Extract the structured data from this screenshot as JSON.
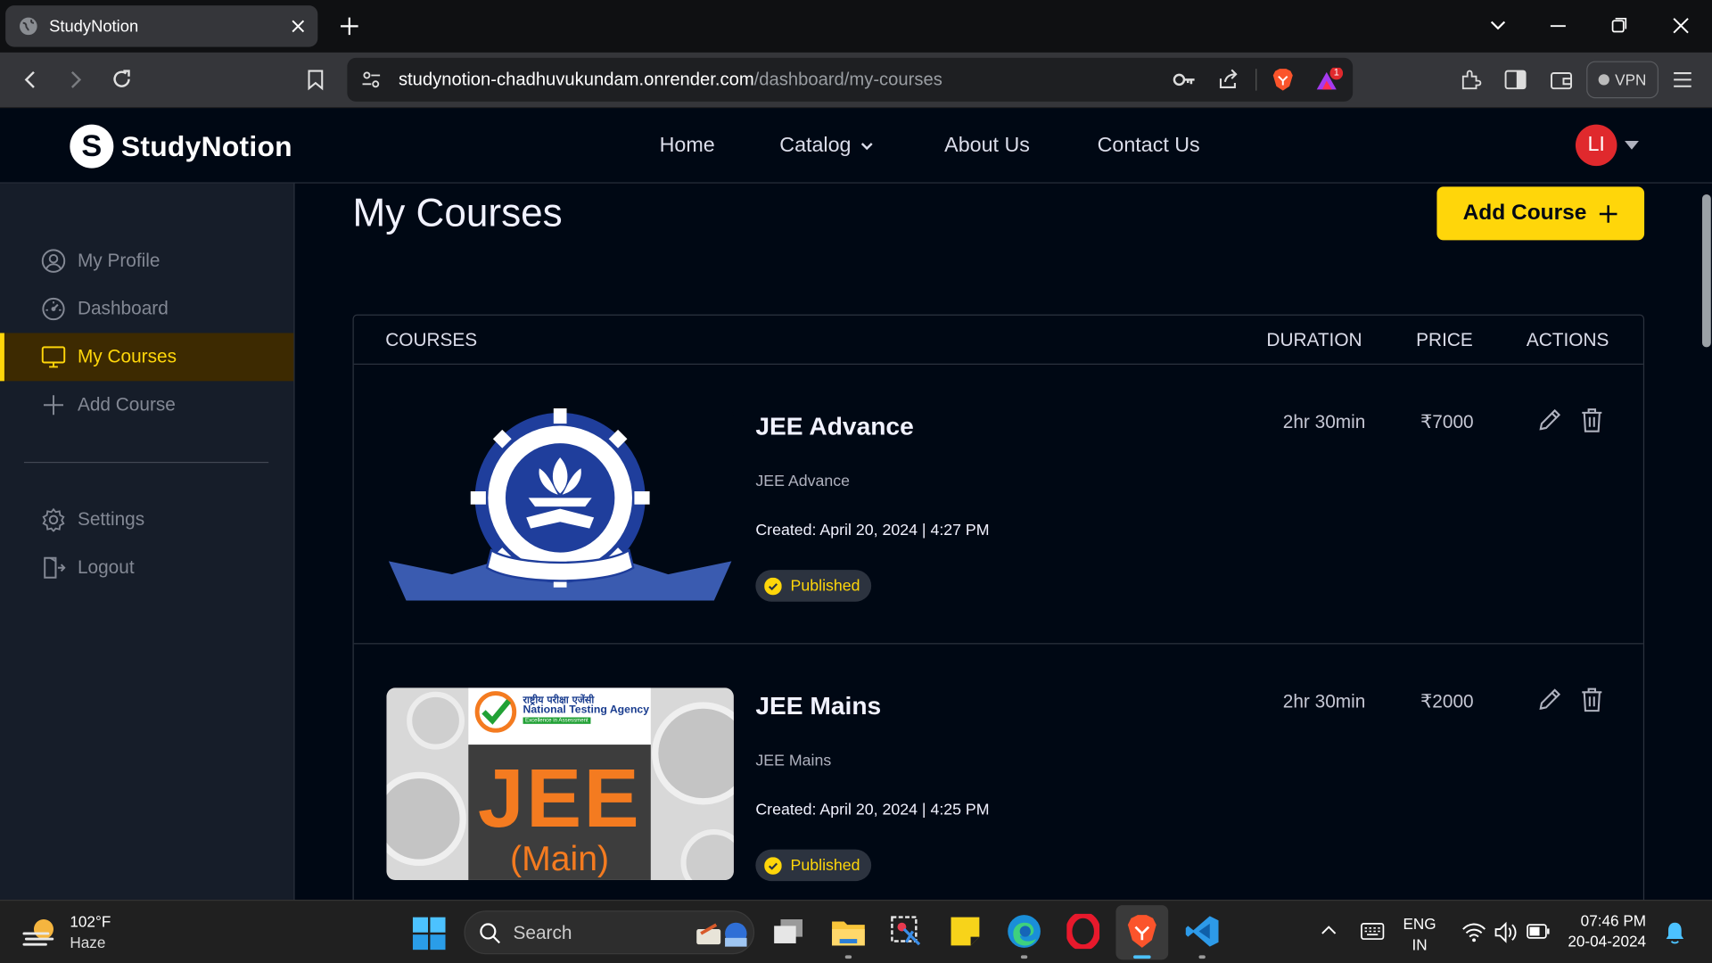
{
  "browser": {
    "tab_title": "StudyNotion",
    "url_domain": "studynotion-chadhuvukundam.onrender.com",
    "url_path": "/dashboard/my-courses",
    "notification_count": "1",
    "vpn_label": "VPN"
  },
  "site": {
    "brand": "StudyNotion",
    "brand_letter": "S",
    "nav": {
      "home": "Home",
      "catalog": "Catalog",
      "about": "About Us",
      "contact": "Contact Us"
    },
    "avatar_initials": "LI"
  },
  "sidebar": {
    "items": [
      {
        "label": "My Profile",
        "icon": "user-circle-icon"
      },
      {
        "label": "Dashboard",
        "icon": "speedometer-icon"
      },
      {
        "label": "My Courses",
        "icon": "monitor-icon",
        "active": true
      },
      {
        "label": "Add Course",
        "icon": "plus-icon"
      }
    ],
    "bottom_items": [
      {
        "label": "Settings",
        "icon": "gear-icon"
      },
      {
        "label": "Logout",
        "icon": "logout-icon"
      }
    ]
  },
  "main": {
    "title": "My Courses",
    "add_course_label": "Add Course",
    "table": {
      "headers": {
        "courses": "COURSES",
        "duration": "DURATION",
        "price": "PRICE",
        "actions": "ACTIONS"
      },
      "rows": [
        {
          "name": "JEE Advance",
          "description": "JEE Advance",
          "created": "Created: April 20, 2024 | 4:27 PM",
          "status": "Published",
          "duration": "2hr 30min",
          "price": "₹7000"
        },
        {
          "name": "JEE Mains",
          "description": "JEE Mains",
          "created": "Created: April 20, 2024 | 4:25 PM",
          "status": "Published",
          "duration": "2hr 30min",
          "price": "₹2000",
          "thumb_text": {
            "hindi": "राष्ट्रीय परीक्षा एजेंसी",
            "agency": "National Testing Agency",
            "tagline": "Excellence in Assessment",
            "big": "JEE",
            "sub": "(Main)"
          }
        }
      ]
    }
  },
  "taskbar": {
    "temperature": "102°F",
    "condition": "Haze",
    "search_label": "Search",
    "lang_top": "ENG",
    "lang_bottom": "IN",
    "time": "07:46 PM",
    "date": "20-04-2024"
  },
  "colors": {
    "accent": "#ffd60a",
    "background": "#000814",
    "sidebar": "#161d29",
    "avatar": "#e0292d"
  }
}
